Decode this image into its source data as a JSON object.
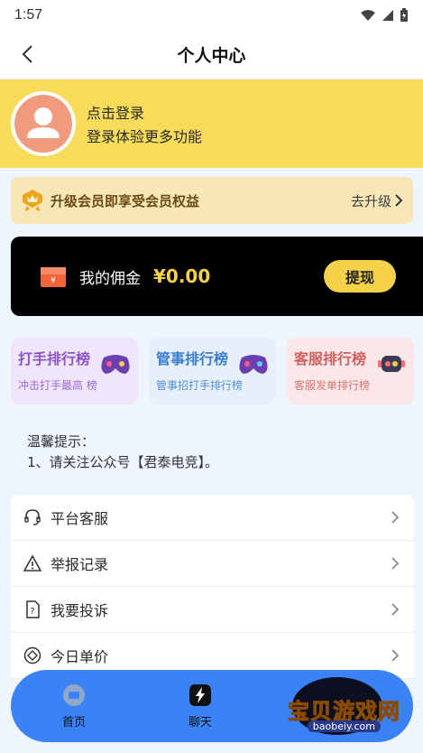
{
  "status_bar": {
    "time": "1:57"
  },
  "header": {
    "title": "个人中心"
  },
  "profile": {
    "login_title": "点击登录",
    "login_subtitle": "登录体验更多功能"
  },
  "vip": {
    "text": "升级会员即享受会员权益",
    "action": "去升级"
  },
  "commission": {
    "label": "我的佣金",
    "value": "¥0.00",
    "withdraw": "提现"
  },
  "ranks": [
    {
      "title": "打手排行榜",
      "subtitle": "冲击打手最高 榜"
    },
    {
      "title": "管事排行榜",
      "subtitle": "管事招打手排行榜"
    },
    {
      "title": "客服排行榜",
      "subtitle": "客服发单排行榜"
    }
  ],
  "tips": {
    "title": "温馨提示：",
    "line1": "1、请关注公众号【君泰电竞】。"
  },
  "menu": [
    {
      "label": "平台客服",
      "icon": "headset-icon"
    },
    {
      "label": "举报记录",
      "icon": "warning-icon"
    },
    {
      "label": "我要投诉",
      "icon": "complaint-icon"
    },
    {
      "label": "今日单价",
      "icon": "price-icon"
    }
  ],
  "bottom_nav": {
    "home": "首页",
    "chat": "聊天"
  },
  "watermark": {
    "text": "宝贝游戏网",
    "url": "baobeiy.com"
  }
}
